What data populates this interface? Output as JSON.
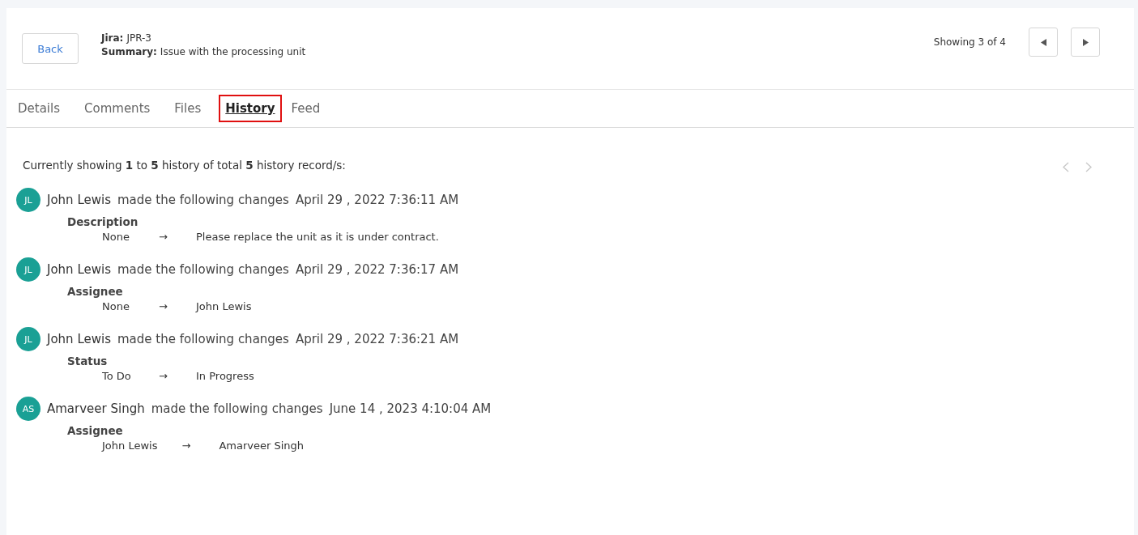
{
  "header": {
    "back_button": "Back",
    "jira_label": "Jira:",
    "jira_value": "JPR-3",
    "summary_label": "Summary:",
    "summary_value": "Issue with the processing unit",
    "counter": "Showing 3 of 4"
  },
  "tabs": [
    {
      "label": "Details",
      "selected": false
    },
    {
      "label": "Comments",
      "selected": false
    },
    {
      "label": "Files",
      "selected": false
    },
    {
      "label": "History",
      "selected": true
    },
    {
      "label": "Feed",
      "selected": false
    }
  ],
  "history": {
    "summary": "Currently showing **1** to **5** history of total  **5**  history record/s:",
    "entries": [
      {
        "initials": "JL",
        "author": "John Lewis",
        "action": "made the following changes",
        "timestamp": "April 29 , 2022 7:36:11 AM",
        "field": "Description",
        "from": "None",
        "arrow": "→",
        "to": "Please replace the unit as it is under contract."
      },
      {
        "initials": "JL",
        "author": "John Lewis",
        "action": "made the following changes",
        "timestamp": "April 29 , 2022 7:36:17 AM",
        "field": "Assignee",
        "from": "None",
        "arrow": "→",
        "to": "John Lewis"
      },
      {
        "initials": "JL",
        "author": "John Lewis",
        "action": "made the following changes",
        "timestamp": "April 29 , 2022 7:36:21 AM",
        "field": "Status",
        "from": "To Do",
        "arrow": "→",
        "to": "In Progress"
      },
      {
        "initials": "AS",
        "author": "Amarveer Singh",
        "action": "made the following changes",
        "timestamp": "June 14 , 2023 4:10:04 AM",
        "field": "Assignee",
        "from": "John Lewis",
        "arrow": "→",
        "to": "Amarveer Singh"
      }
    ]
  }
}
